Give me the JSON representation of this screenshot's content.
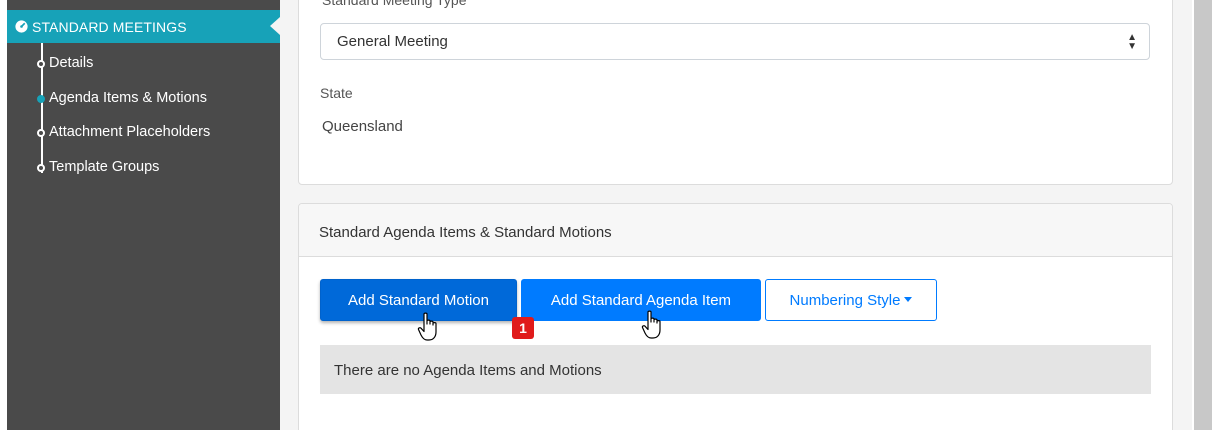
{
  "sidebar": {
    "section_title": "STANDARD MEETINGS",
    "section_icon": "dashboard-icon",
    "items": [
      {
        "label": "Details",
        "active": false
      },
      {
        "label": "Agenda Items & Motions",
        "active": true
      },
      {
        "label": "Attachment Placeholders",
        "active": false
      },
      {
        "label": "Template Groups",
        "active": false
      }
    ]
  },
  "meeting_form": {
    "type_label": "Standard Meeting Type",
    "type_value": "General Meeting",
    "state_label": "State",
    "state_value": "Queensland"
  },
  "agenda_card": {
    "title": "Standard Agenda Items & Standard Motions",
    "add_motion_label": "Add Standard Motion",
    "add_agenda_label": "Add Standard Agenda Item",
    "numbering_label": "Numbering Style",
    "empty_message": "There are no Agenda Items and Motions"
  },
  "annotation": {
    "step_badge": "1"
  },
  "colors": {
    "sidebar_bg": "#4a4a4a",
    "active_teal": "#17a2b8",
    "primary": "#007bff",
    "badge_red": "#e01b1b"
  }
}
